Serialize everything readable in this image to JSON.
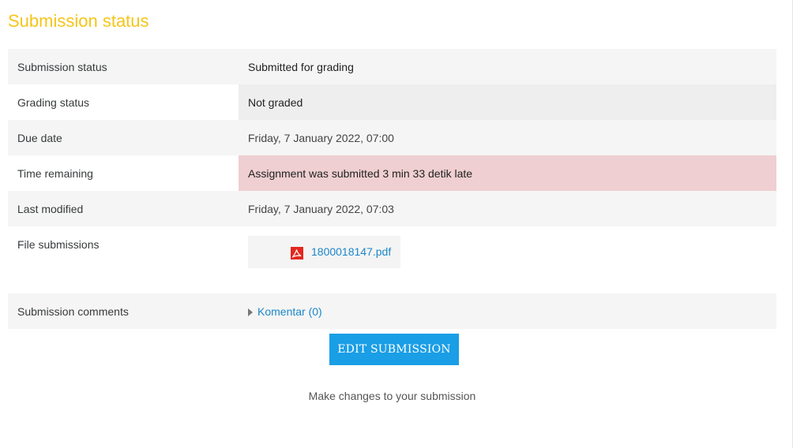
{
  "heading": "Submission status",
  "rows": {
    "submission_status": {
      "label": "Submission status",
      "value": "Submitted for grading"
    },
    "grading_status": {
      "label": "Grading status",
      "value": "Not graded"
    },
    "due_date": {
      "label": "Due date",
      "value": "Friday, 7 January 2022, 07:00"
    },
    "time_remaining": {
      "label": "Time remaining",
      "value": "Assignment was submitted 3 min 33 detik late"
    },
    "last_modified": {
      "label": "Last modified",
      "value": "Friday, 7 January 2022, 07:03"
    },
    "file_submissions": {
      "label": "File submissions",
      "file_name": "1800018147.pdf",
      "file_icon": "pdf-icon"
    },
    "submission_comments": {
      "label": "Submission comments",
      "toggle_label": "Komentar (0)"
    }
  },
  "actions": {
    "edit_label": "EDIT SUBMISSION",
    "edit_help": "Make changes to your submission"
  },
  "colors": {
    "heading": "#f5c518",
    "late_bg": "#efcfd1",
    "link": "#1b87c9",
    "button_bg": "#1a9ee6"
  }
}
